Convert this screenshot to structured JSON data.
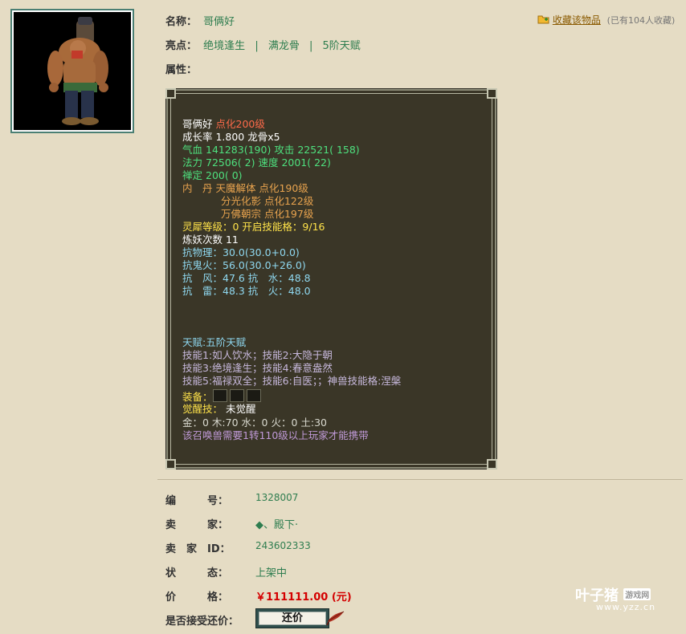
{
  "item": {
    "name_label": "名称：",
    "name": "哥俩好",
    "highlights_label": "亮点：",
    "highlights": [
      "绝境逢生",
      "满龙骨",
      "5阶天赋"
    ],
    "highlight_sep": "|",
    "attributes_label": "属性："
  },
  "favorite": {
    "link": "收藏该物品",
    "count": "(已有104人收藏)"
  },
  "panel": {
    "name": "哥俩好",
    "level": "点化200级",
    "growth": "成长率 1.800 龙骨x5",
    "hp_label": "气血",
    "hp": "141283(190)",
    "atk_label": "攻击",
    "atk": "22521( 158)",
    "mp_label": "法力",
    "mp": "72506( 2)",
    "spd_label": "速度",
    "spd": "2001( 22)",
    "zen_label": "禅定",
    "zen": "200( 0)",
    "neidan_label": "内　丹",
    "neidan": [
      "天魔解体 点化190级",
      "分光化影 点化122级",
      "万佛朝宗 点化197级"
    ],
    "rhino": "灵犀等级：0 开启技能格：9/16",
    "refine": "炼妖次数 11",
    "res_phys": "抗物理：30.0(30.0+0.0)",
    "res_ghost": "抗鬼火：56.0(30.0+26.0)",
    "res_wind_water": "抗　风：47.6 抗　水：48.8",
    "res_thunder_fire": "抗　雷：48.3 抗　火：48.0",
    "talent": "天赋:五阶天赋",
    "skills_1": "技能1:如人饮水；技能2:大隐于朝",
    "skills_2": "技能3:绝境逢生；技能4:春意盎然",
    "skills_3": "技能5:福禄双全；技能6:自医；；神兽技能格:涅槃",
    "equip_label": "装备：",
    "awaken_label": "觉醒技：",
    "awaken": "未觉醒",
    "elements": "金：0 木:70 水：0 火：0 土:30",
    "requirement": "该召唤兽需要1转110级以上玩家才能携带"
  },
  "details": {
    "id_label": "编　　　号：",
    "id": "1328007",
    "seller_label": "卖　　　家：",
    "seller": "◆、殿下·",
    "seller_id_label": "卖　家　ID：",
    "seller_id": "243602333",
    "status_label": "状　　　态：",
    "status": "上架中",
    "price_label": "价　　　格：",
    "price": "￥111111.00 (元)",
    "bargain_label": "是否接受还价：",
    "bargain_button": "还价"
  },
  "watermark": {
    "brand": "叶子猪",
    "badge": "游戏网",
    "url": "www.yzz.cn"
  },
  "colors": {
    "background": "#e5dcc4",
    "panel": "#3a3627",
    "link_green": "#2e7d4f",
    "price_red": "#d40000"
  }
}
